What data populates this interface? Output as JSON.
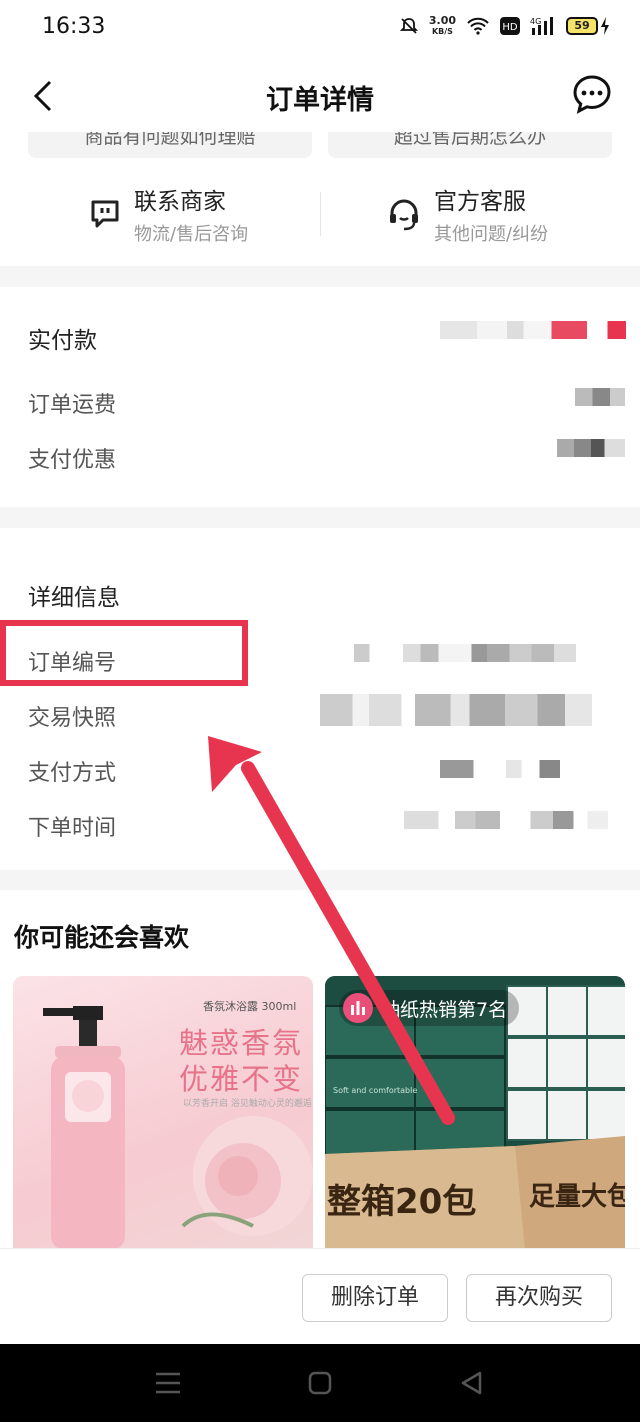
{
  "status_bar": {
    "time": "16:33",
    "speed_value": "3.00",
    "speed_unit": "KB/S",
    "network": "4G",
    "battery": "59"
  },
  "nav": {
    "title": "订单详情"
  },
  "help": {
    "faq": [
      "商品有问题如何理赔",
      "超过售后期怎么办"
    ],
    "contacts": [
      {
        "title": "联系商家",
        "subtitle": "物流/售后咨询",
        "icon": "store-chat-icon"
      },
      {
        "title": "官方客服",
        "subtitle": "其他问题/纠纷",
        "icon": "headset-icon"
      }
    ]
  },
  "payment": {
    "paid_label": "实付款",
    "shipping_label": "订单运费",
    "discount_label": "支付优惠"
  },
  "details": {
    "header": "详细信息",
    "order_no_label": "订单编号",
    "snapshot_label": "交易快照",
    "pay_method_label": "支付方式",
    "order_time_label": "下单时间"
  },
  "recommend": {
    "title": "你可能还会喜欢",
    "products": [
      {
        "tag": "香氛沐浴露 300ml",
        "line1": "魅惑香氛",
        "line2": "优雅不变",
        "small": "以芳香开启 浴见触动心灵的邂逅"
      },
      {
        "badge": "抽纸热销第7名",
        "banner1": "整箱20包",
        "banner2": "足量大包",
        "pack_text": "Soft and comfortable"
      }
    ]
  },
  "bottom": {
    "delete_label": "删除订单",
    "rebuy_label": "再次购买"
  },
  "colors": {
    "accent": "#e8354f",
    "highlight": "#e8354f"
  }
}
